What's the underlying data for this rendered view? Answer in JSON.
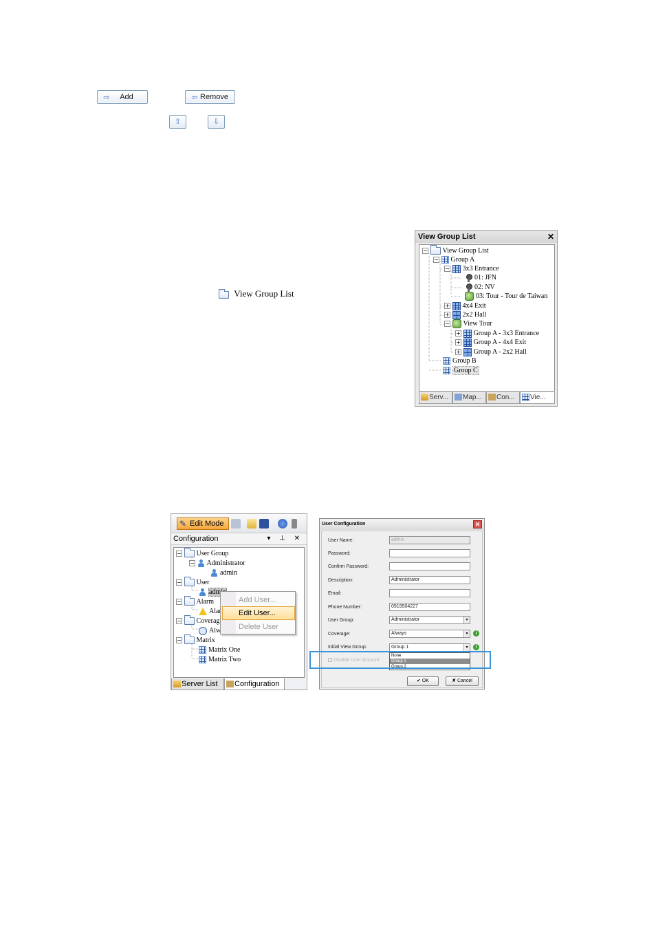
{
  "buttons": {
    "add": "Add",
    "remove": "Remove",
    "up_icon": "up-arrow-icon",
    "down_icon": "down-arrow-icon"
  },
  "inline_label": {
    "text": "View Group List"
  },
  "view_group_panel": {
    "title": "View Group List",
    "close": "✕",
    "tree": {
      "root": "View Group List",
      "group_a": "Group A",
      "entrance": "3x3 Entrance",
      "cam1": "01: JFN",
      "cam2": "02: NV",
      "cam3": "03: Tour - Tour de Taiwan",
      "exit": "4x4 Exit",
      "hall": "2x2 Hall",
      "view_tour": "View Tour",
      "tour1": "Group A - 3x3 Entrance",
      "tour2": "Group A - 4x4 Exit",
      "tour3": "Group A - 2x2 Hall",
      "group_b": "Group B",
      "group_c": "Group C"
    },
    "tabs": [
      "Serv...",
      "Map...",
      "Con...",
      "Vie..."
    ]
  },
  "config_panel": {
    "edit_mode": "Edit Mode",
    "title": "Configuration",
    "controls": "▾ ⊥ ✕",
    "tree": {
      "user_group": "User Group",
      "administrator": "Administrator",
      "admin": "admin",
      "user": "User",
      "user_admin": "admin",
      "alarm": "Alarm",
      "alarm_child": "Alar",
      "coverage": "Coverag",
      "coverage_child": "Alw",
      "matrix": "Matrix",
      "matrix_one": "Matrix One",
      "matrix_two": "Matrix Two"
    },
    "context_menu": [
      "Add User...",
      "Edit User...",
      "Delete User"
    ],
    "tabs": [
      "Server List",
      "Configuration"
    ]
  },
  "user_dialog": {
    "title": "User Configuration",
    "labels": {
      "user_name": "User Name:",
      "password": "Password:",
      "confirm_password": "Confirm Password:",
      "description": "Description:",
      "email": "Email:",
      "phone": "Phone Number:",
      "user_group": "User Group:",
      "coverage": "Coverage:",
      "initial_view_group": "Initial View Group:",
      "disable": "Disable User Account"
    },
    "values": {
      "user_name": "admin",
      "description": "Administrator",
      "phone": "0919504227",
      "user_group": "Administrator",
      "coverage": "Always",
      "initial_view_group": "Group 1"
    },
    "dropdown_options": [
      "None",
      "Group 1",
      "Group 2"
    ],
    "ok": "OK",
    "cancel": "Cancel"
  }
}
